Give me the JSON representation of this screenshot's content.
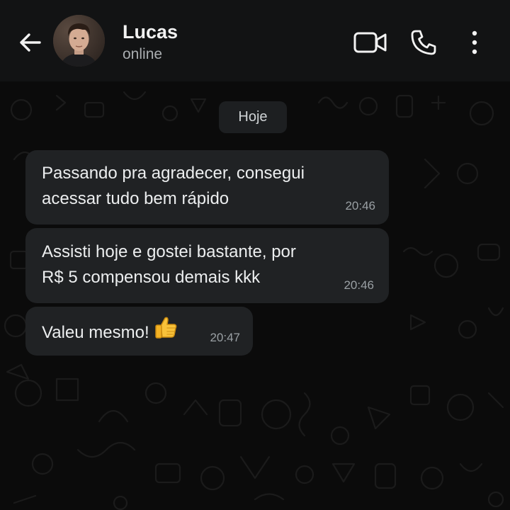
{
  "contact": {
    "name": "Lucas",
    "status": "online"
  },
  "header_icons": [
    "back-arrow-icon",
    "video-call-icon",
    "phone-icon",
    "more-vert-icon"
  ],
  "chat": {
    "date_chip": "Hoje",
    "messages": [
      {
        "text": "Passando pra agradecer, consegui\nacessar tudo bem rápido",
        "time": "20:46"
      },
      {
        "text": "Assisti hoje e gostei bastante, por\nR$ 5 compensou demais kkk",
        "time": "20:46"
      },
      {
        "text": "Valeu mesmo!",
        "emoji": "thumbs-up",
        "time": "20:47"
      }
    ]
  },
  "colors": {
    "header_bg": "#121314",
    "chat_bg": "#0b0b0b",
    "bubble_bg": "#202224",
    "text": "#e9edef",
    "secondary_text": "#a9adb0"
  }
}
